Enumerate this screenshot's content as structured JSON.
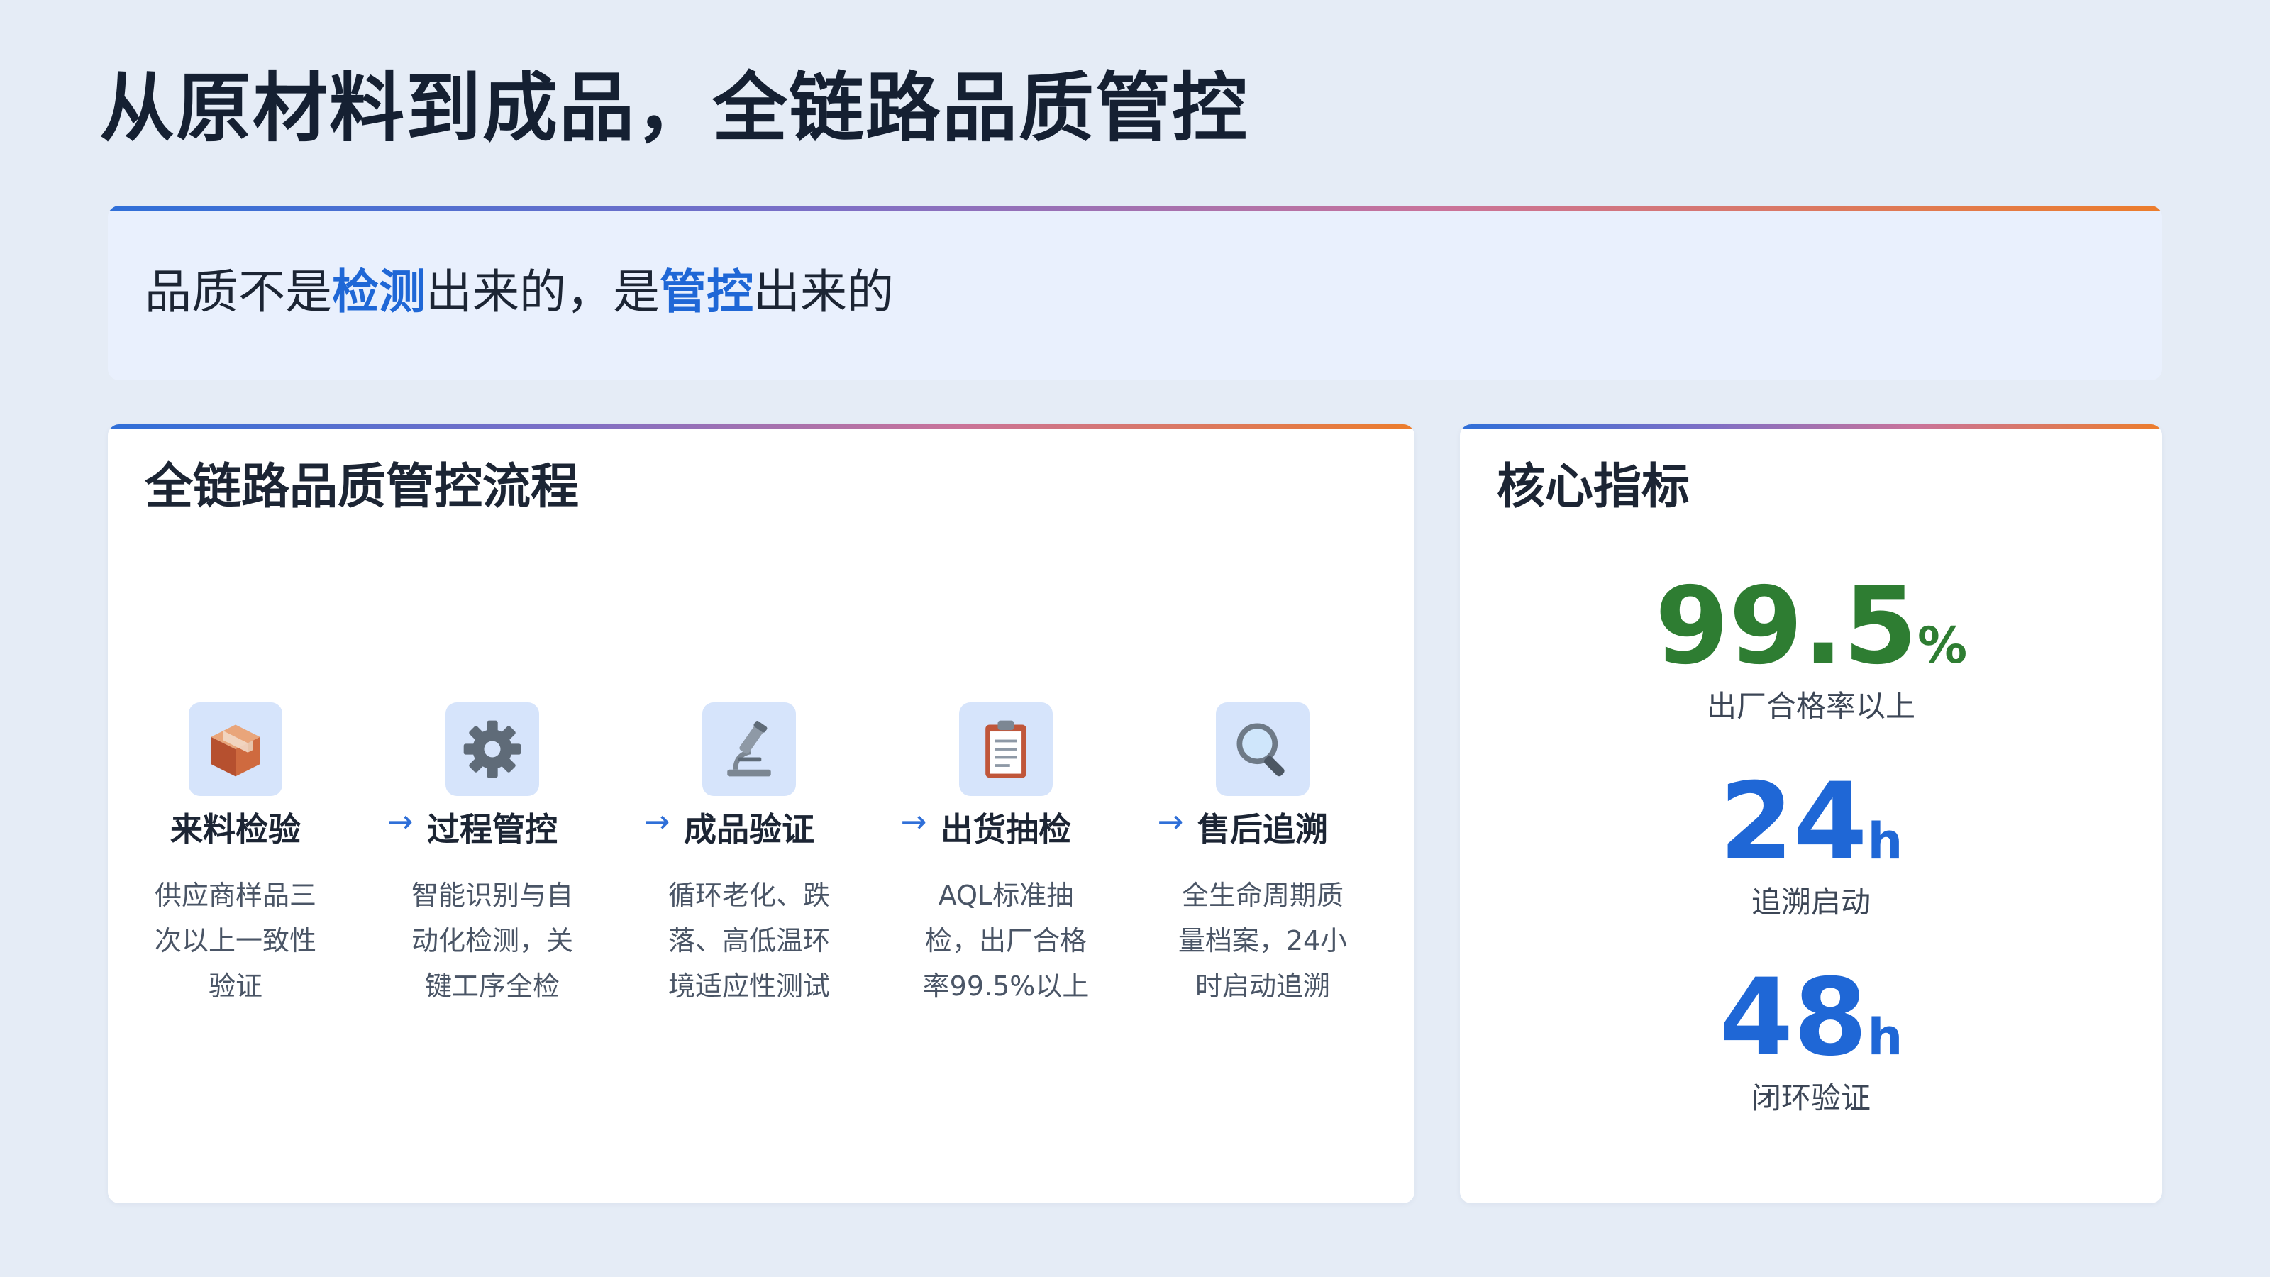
{
  "page": {
    "title": "从原材料到成品，全链路品质管控"
  },
  "slogan": {
    "part1": "品质不是",
    "highlight1": "检测",
    "part2": "出来的，是",
    "highlight2": "管控",
    "part3": "出来的"
  },
  "process": {
    "title": "全链路品质管控流程",
    "arrow": "→",
    "steps": [
      {
        "icon": "package-icon",
        "title": "来料检验",
        "desc": "供应商样品三次以上一致性验证"
      },
      {
        "icon": "gear-icon",
        "title": "过程管控",
        "desc": "智能识别与自动化检测，关键工序全检"
      },
      {
        "icon": "microscope-icon",
        "title": "成品验证",
        "desc": "循环老化、跌落、高低温环境适应性测试"
      },
      {
        "icon": "clipboard-icon",
        "title": "出货抽检",
        "desc": "AQL标准抽检，出厂合格率99.5%以上"
      },
      {
        "icon": "magnifier-icon",
        "title": "售后追溯",
        "desc": "全生命周期质量档案，24小时启动追溯"
      }
    ]
  },
  "metrics": {
    "title": "核心指标",
    "items": [
      {
        "value": "99.5",
        "unit": "%",
        "label": "出厂合格率以上",
        "color": "#2e7d32"
      },
      {
        "value": "24",
        "unit": "h",
        "label": "追溯启动",
        "color": "#1f67d6"
      },
      {
        "value": "48",
        "unit": "h",
        "label": "闭环验证",
        "color": "#1f67d6"
      }
    ]
  },
  "colors": {
    "accent_blue": "#1f67d6",
    "accent_green": "#2e7d32",
    "gradient": [
      "#2f6fd8",
      "#7d6fc6",
      "#c9739a",
      "#ec7d2c"
    ]
  }
}
